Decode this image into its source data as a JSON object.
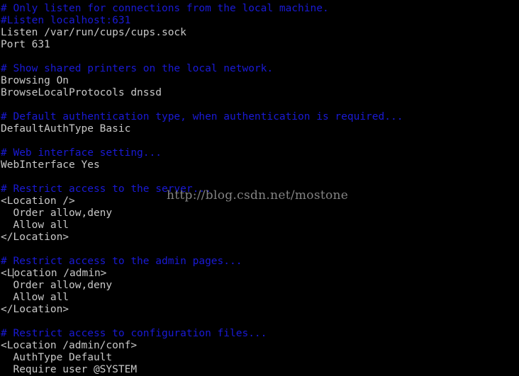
{
  "lines": [
    {
      "text": "# Only listen for connections from the local machine.",
      "kind": "comment"
    },
    {
      "text": "#Listen localhost:631",
      "kind": "comment"
    },
    {
      "text": "Listen /var/run/cups/cups.sock",
      "kind": "text"
    },
    {
      "text": "Port 631",
      "kind": "text"
    },
    {
      "text": "",
      "kind": "text"
    },
    {
      "text": "# Show shared printers on the local network.",
      "kind": "comment"
    },
    {
      "text": "Browsing On",
      "kind": "text"
    },
    {
      "text": "BrowseLocalProtocols dnssd",
      "kind": "text"
    },
    {
      "text": "",
      "kind": "text"
    },
    {
      "text": "# Default authentication type, when authentication is required...",
      "kind": "comment"
    },
    {
      "text": "DefaultAuthType Basic",
      "kind": "text"
    },
    {
      "text": "",
      "kind": "text"
    },
    {
      "text": "# Web interface setting...",
      "kind": "comment"
    },
    {
      "text": "WebInterface Yes",
      "kind": "text"
    },
    {
      "text": "",
      "kind": "text"
    },
    {
      "text": "# Restrict access to the server...",
      "kind": "comment"
    },
    {
      "text": "<Location />",
      "kind": "text"
    },
    {
      "text": "  Order allow,deny",
      "kind": "text"
    },
    {
      "text": "  Allow all",
      "kind": "text"
    },
    {
      "text": "</Location>",
      "kind": "text"
    },
    {
      "text": "",
      "kind": "text"
    },
    {
      "text": "# Restrict access to the admin pages...",
      "kind": "comment"
    },
    {
      "text": "<Location /admin>",
      "kind": "text",
      "cursor_after_chars": 2
    },
    {
      "text": "  Order allow,deny",
      "kind": "text"
    },
    {
      "text": "  Allow all",
      "kind": "text"
    },
    {
      "text": "</Location>",
      "kind": "text"
    },
    {
      "text": "",
      "kind": "text"
    },
    {
      "text": "# Restrict access to configuration files...",
      "kind": "comment"
    },
    {
      "text": "<Location /admin/conf>",
      "kind": "text"
    },
    {
      "text": "  AuthType Default",
      "kind": "text"
    },
    {
      "text": "  Require user @SYSTEM",
      "kind": "text"
    }
  ],
  "watermark": "http://blog.csdn.net/mostone",
  "colors": {
    "background": "#000000",
    "text": "#c8c8c8",
    "comment": "#1a1ad6",
    "watermark": "#9a9a9a"
  }
}
